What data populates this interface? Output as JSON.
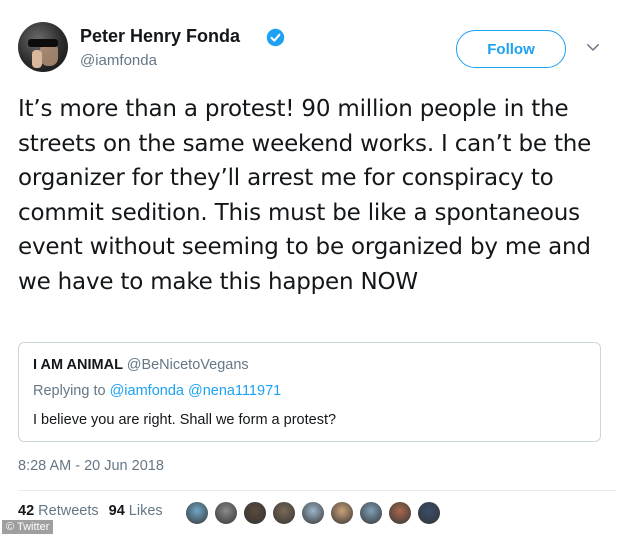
{
  "user": {
    "name": "Peter Henry Fonda",
    "handle": "@iamfonda",
    "verified": true
  },
  "follow_label": "Follow",
  "tweet": {
    "text": "It’s more than a protest! 90 million people in the streets on the same weekend works. I can’t be the organizer for they’ll arrest me for conspiracy to commit sedition. This must be like a spontaneous event without seeming to be organized by me and we have to make this happen NOW",
    "timestamp": "8:28 AM - 20 Jun 2018"
  },
  "quoted": {
    "name": "I AM ANIMAL",
    "handle": "@BeNicetoVegans",
    "replying_prefix": "Replying to",
    "replying_to": [
      "@iamfonda",
      "@nena111971"
    ],
    "text": "I believe you are right. Shall we form a protest?"
  },
  "stats": {
    "retweets_count": "42",
    "retweets_label": "Retweets",
    "likes_count": "94",
    "likes_label": "Likes"
  },
  "likers_colors": [
    "#6fa8c7",
    "#8a8a8a",
    "#5a4a3c",
    "#7b6a58",
    "#9db6c9",
    "#c9a27a",
    "#7f9fb8",
    "#a86a4e",
    "#3a4e6b"
  ],
  "watermark": "© Twitter",
  "colors": {
    "accent": "#1da1f2",
    "secondary_text": "#657786"
  }
}
